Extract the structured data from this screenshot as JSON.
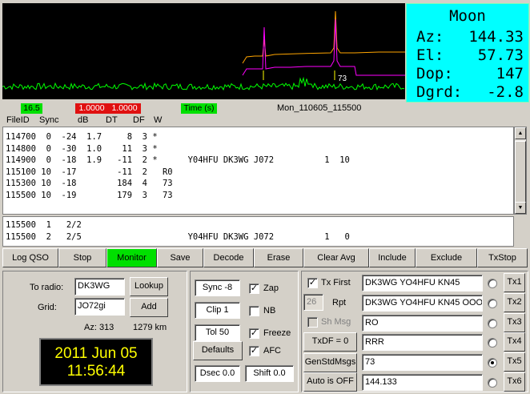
{
  "moon": {
    "title": "Moon",
    "rows": [
      {
        "label": "Az:",
        "value": "144.33"
      },
      {
        "label": "El:",
        "value": "57.73"
      },
      {
        "label": "Dop:",
        "value": "147"
      },
      {
        "label": "Dgrd:",
        "value": "-2.8"
      }
    ]
  },
  "spectrum": {
    "marker_label": "73",
    "colors": {
      "background": "#000000",
      "noise": "#00ff00",
      "trace_orange": "#ffa500",
      "trace_magenta": "#ff00ff",
      "marker": "#ffff00"
    }
  },
  "status": {
    "zero": "16.5",
    "red_a": "1.0000",
    "red_b": "1.0000",
    "time_label": "Time (s)",
    "filename": "Mon_110605_115500"
  },
  "columns": [
    "FileID",
    "Sync",
    "dB",
    "DT",
    "DF",
    "W"
  ],
  "decoded_lines": [
    "114700  0  -24  1.7     8  3 *",
    "114800  0  -30  1.0    11  3 *",
    "114900  0  -18  1.9   -11  2 *      Y04HFU DK3WG J072          1  10",
    "115100 10  -17        -11  2   R0",
    "115300 10  -18        184  4   73",
    "115500 10  -19        179  3   73"
  ],
  "average_lines": [
    "115500  1   2/2",
    "115500  2   2/5                     Y04HFU DK3WG J072          1   0"
  ],
  "buttons": [
    "Log QSO",
    "Stop",
    "Monitor",
    "Save",
    "Decode",
    "Erase",
    "Clear Avg",
    "Include",
    "Exclude",
    "TxStop"
  ],
  "station": {
    "to_radio_label": "To radio:",
    "to_radio_value": "DK3WG",
    "lookup": "Lookup",
    "grid_label": "Grid:",
    "grid_value": "JO72gi",
    "add": "Add",
    "az": "Az: 313",
    "dist": "1279 km"
  },
  "clock": {
    "date": "2011 Jun 05",
    "time": "11:56:44"
  },
  "controls": {
    "sync": "Sync  -8",
    "clip": "Clip  1",
    "tol": "Tol   50",
    "defaults": "Defaults",
    "dsec": "Dsec  0.0",
    "shift": "Shift 0.0",
    "zap": "Zap",
    "nb": "NB",
    "freeze": "Freeze",
    "afc": "AFC"
  },
  "tx": {
    "tx_first": "Tx First",
    "rpt_value": "26",
    "rpt_label": "Rpt",
    "sh_msg": "Sh Msg",
    "txdf": "TxDF = 0",
    "gen_std": "GenStdMsgs",
    "auto": "Auto is OFF",
    "messages": [
      "DK3WG YO4HFU KN45",
      "DK3WG YO4HFU KN45 OOO",
      "RO",
      "RRR",
      "73",
      "144.133"
    ],
    "tx_buttons": [
      "Tx1",
      "Tx2",
      "Tx3",
      "Tx4",
      "Tx5",
      "Tx6"
    ],
    "selected_index": 4
  }
}
